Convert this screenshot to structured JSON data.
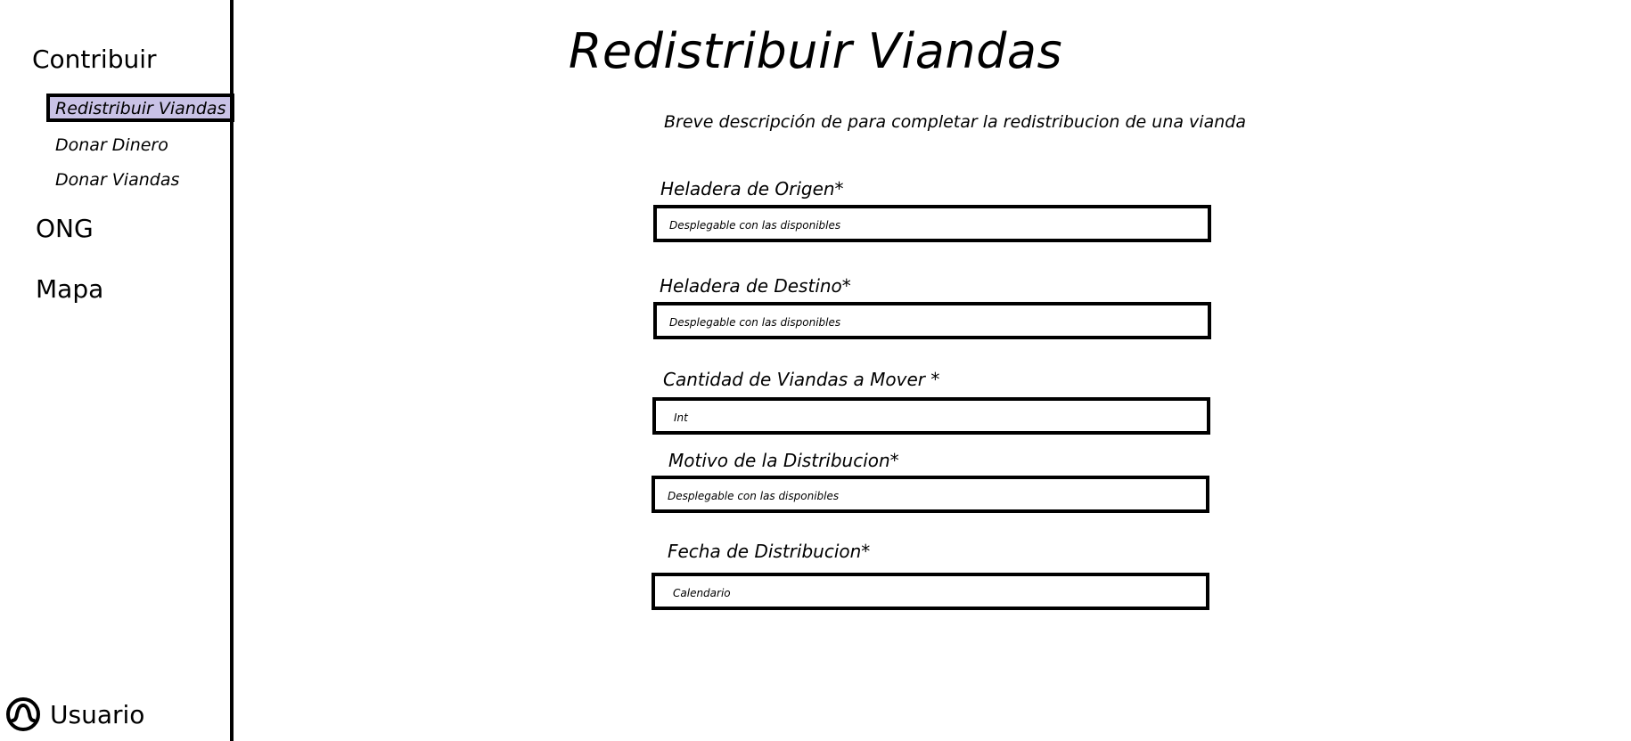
{
  "sidebar": {
    "sections": [
      {
        "label": "Contribuir"
      },
      {
        "label": "ONG"
      },
      {
        "label": "Mapa"
      }
    ],
    "sub_items": [
      {
        "label": "Redistribuir Viandas",
        "active": true
      },
      {
        "label": "Donar Dinero"
      },
      {
        "label": "Donar Viandas"
      }
    ],
    "user": {
      "label": "Usuario",
      "icon": "user-icon"
    }
  },
  "main": {
    "title": "Redistribuir Viandas",
    "description": "Breve descripción de para completar la redistribucion de una vianda",
    "fields": [
      {
        "label": "Heladera de Origen*",
        "placeholder": "Desplegable con las disponibles"
      },
      {
        "label": "Heladera de Destino*",
        "placeholder": "Desplegable con las disponibles"
      },
      {
        "label": "Cantidad de Viandas a Mover *",
        "placeholder": "Int"
      },
      {
        "label": "Motivo de la Distribucion*",
        "placeholder": "Desplegable con las disponibles"
      },
      {
        "label": "Fecha de Distribucion*",
        "placeholder": "Calendario"
      }
    ]
  },
  "colors": {
    "active_highlight": "#c9c2e6",
    "border": "#000000"
  }
}
